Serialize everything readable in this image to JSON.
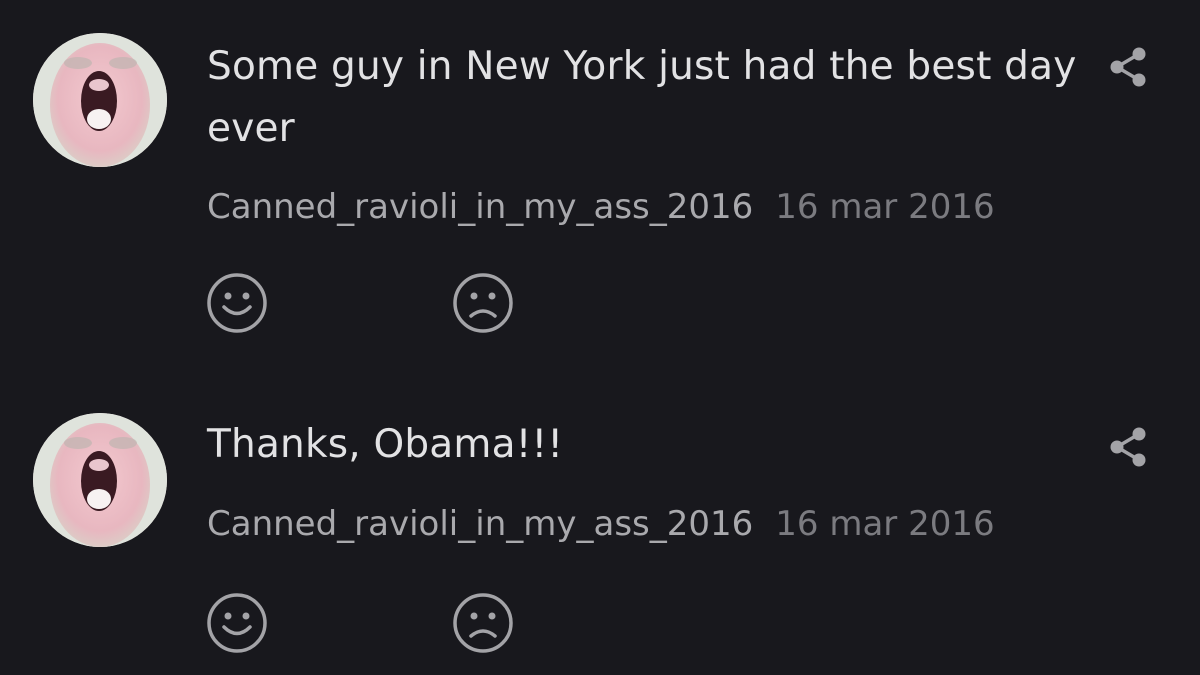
{
  "colors": {
    "background": "#18181d",
    "comment_text": "#e2e2e4",
    "author_text": "#a9a9ad",
    "date_text": "#7b7b80",
    "icon": "#a3a3a7"
  },
  "comments": [
    {
      "text": "Some guy in New York just had the best day ever",
      "author": "Canned_ravioli_in_my_ass_2016",
      "date": "16 mar 2016",
      "avatar_icon": "avatar-photo",
      "share_icon": "share-icon",
      "like_icon": "smiley-face-icon",
      "dislike_icon": "sad-face-icon"
    },
    {
      "text": "Thanks, Obama!!!",
      "author": "Canned_ravioli_in_my_ass_2016",
      "date": "16 mar 2016",
      "avatar_icon": "avatar-photo",
      "share_icon": "share-icon",
      "like_icon": "smiley-face-icon",
      "dislike_icon": "sad-face-icon"
    }
  ]
}
